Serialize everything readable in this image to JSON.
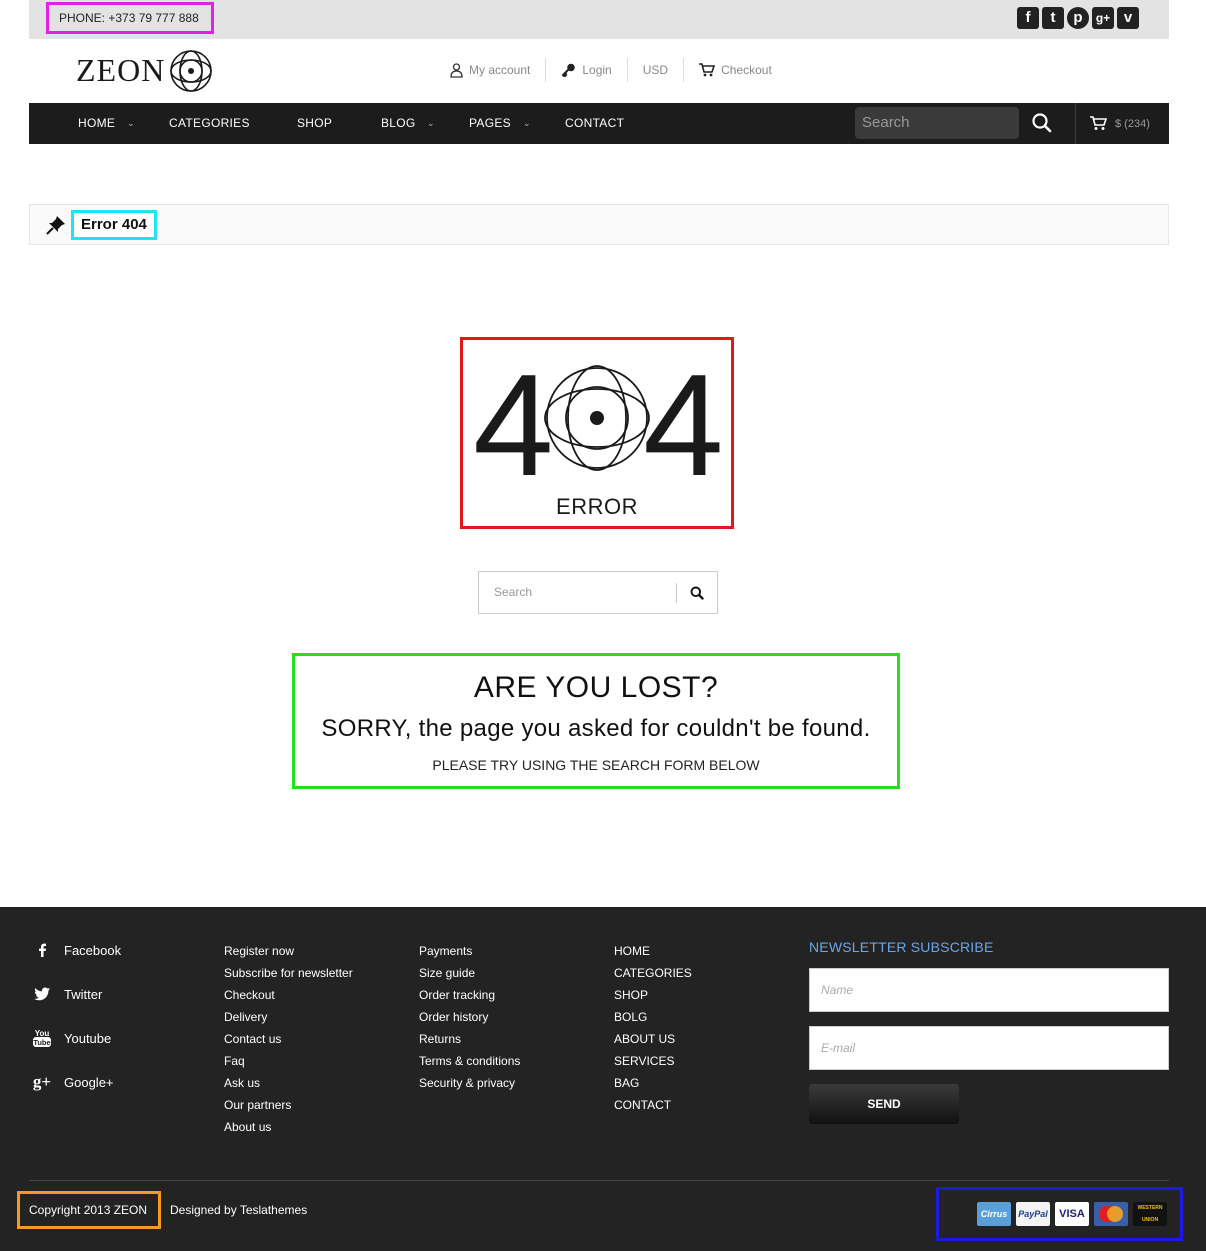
{
  "topbar": {
    "phone": "PHONE: +373 79 777 888",
    "social_icons": [
      "facebook-icon",
      "tumblr-icon",
      "pinterest-icon",
      "google-plus-icon",
      "vimeo-icon"
    ]
  },
  "header": {
    "logo": "ZEON",
    "links": [
      {
        "label": "My account",
        "icon": "user-icon"
      },
      {
        "label": "Login",
        "icon": "key-icon"
      },
      {
        "label": "USD"
      },
      {
        "label": "Checkout",
        "icon": "cart-icon"
      }
    ]
  },
  "nav": {
    "items": [
      "HOME",
      "CATEGORIES",
      "SHOP",
      "BLOG",
      "PAGES",
      "CONTACT"
    ],
    "search_placeholder": "Search",
    "cart": "$ (234)"
  },
  "breadcrumb": {
    "title": "Error 404"
  },
  "error": {
    "code": "404",
    "label": "ERROR"
  },
  "search_form": {
    "placeholder": "Search"
  },
  "message": {
    "title": "ARE YOU LOST?",
    "subtitle": "SORRY, the page you asked for couldn't be found.",
    "hint": "PLEASE TRY USING THE SEARCH FORM BELOW"
  },
  "footer": {
    "socials": [
      "Facebook",
      "Twitter",
      "Youtube",
      "Google+"
    ],
    "col1": [
      "Register now",
      "Subscribe for newsletter",
      "Checkout",
      "Delivery",
      "Contact us",
      "Faq",
      "Ask us",
      "Our partners",
      "About us"
    ],
    "col2": [
      "Payments",
      "Size guide",
      "Order tracking",
      "Order history",
      "Returns",
      "Terms & conditions",
      "Security & privacy"
    ],
    "col3": [
      "HOME",
      "CATEGORIES",
      "SHOP",
      "BOLG",
      "ABOUT US",
      "SERVICES",
      "BAG",
      "CONTACT"
    ],
    "newsletter": {
      "title": "NEWSLETTER SUBSCRIBE",
      "name_placeholder": "Name",
      "email_placeholder": "E-mail",
      "send": "SEND"
    },
    "copyright": "Copyright 2013 ZEON",
    "designed": "Designed by Teslathemes",
    "payments": [
      "Cirrus",
      "PayPal",
      "VISA",
      "MasterCard",
      "Western Union"
    ]
  }
}
